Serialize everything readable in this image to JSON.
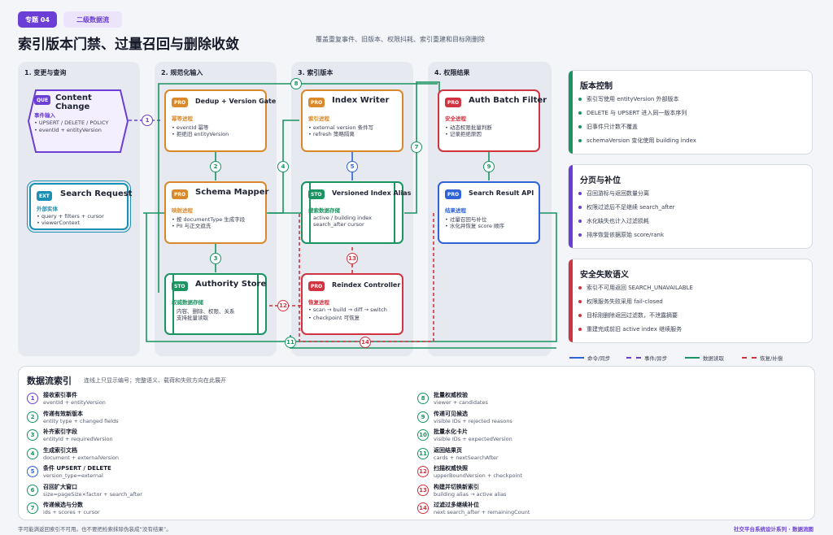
{
  "header": {
    "tag1": "专题 04",
    "tag2": "二级数据流",
    "title": "索引版本门禁、过量召回与删除收敛",
    "subtitle": "覆盖重复事件、旧版本、权限抖耗、索引重建和目标刚删除"
  },
  "panels": [
    {
      "title": "1. 变更与查询"
    },
    {
      "title": "2. 规范化输入"
    },
    {
      "title": "3. 索引版本"
    },
    {
      "title": "4. 权限结果"
    }
  ],
  "nodes": {
    "content_change": {
      "badge": "QUE",
      "title": "Content Change",
      "sub": "事件输入",
      "lines": [
        "UPSERT / DELETE / POLICY",
        "eventId + entityVersion"
      ]
    },
    "search_request": {
      "badge": "EXT",
      "title": "Search Request",
      "sub": "外部实体",
      "lines": [
        "query + filters + cursor",
        "viewerContext"
      ]
    },
    "dedup": {
      "badge": "PRO",
      "title": "Dedup + Version Gate",
      "sub": "幂等进程",
      "lines": [
        "eventId 幂等",
        "拒绝旧 entityVersion"
      ]
    },
    "schema_mapper": {
      "badge": "PRO",
      "title": "Schema Mapper",
      "sub": "映射进程",
      "lines": [
        "按 documentType 生成字段",
        "PII 与正文遮洗"
      ]
    },
    "authority_store": {
      "badge": "STO",
      "title": "Authority Store",
      "sub": "权威数据存储",
      "lines": [
        "内容、删除、权限、关系",
        "支持批量读取"
      ]
    },
    "index_writer": {
      "badge": "PRO",
      "title": "Index Writer",
      "sub": "索引进程",
      "lines": [
        "external version 条件写",
        "refresh 策略隔离"
      ]
    },
    "versioned_alias": {
      "badge": "STO",
      "title": "Versioned Index Alias",
      "sub": "搜索数据存储",
      "lines": [
        "active / building index",
        "search_after cursor"
      ]
    },
    "reindex": {
      "badge": "PRO",
      "title": "Reindex Controller",
      "sub": "恢复进程",
      "lines": [
        "scan → build → diff → switch",
        "checkpoint 可恢复"
      ]
    },
    "auth_batch": {
      "badge": "PRO",
      "title": "Auth Batch Filter",
      "sub": "安全进程",
      "lines": [
        "动态权限批量判断",
        "记录拒绝原因"
      ]
    },
    "search_result": {
      "badge": "PRO",
      "title": "Search Result API",
      "sub": "结果进程",
      "lines": [
        "过量召回与补位",
        "水化并恢复 score 顺序"
      ]
    }
  },
  "flow_numbers": [
    "1",
    "2",
    "3",
    "4",
    "5",
    "6",
    "7",
    "8",
    "9",
    "10",
    "11",
    "12",
    "13",
    "14"
  ],
  "cards": [
    {
      "title": "版本控制",
      "color": "#1a9460",
      "items": [
        "索引写使用 entityVersion 外部版本",
        "DELETE 与 UPSERT 进入同一版本序列",
        "旧事件只计数不覆盖",
        "schemaVersion 变化使用 building index"
      ]
    },
    {
      "title": "分页与补位",
      "color": "#6b3fd6",
      "items": [
        "召回游标与返回数量分离",
        "权限过滤后不足继续 search_after",
        "水化缺失也计入过滤损耗",
        "排序恢复依据原始 score/rank"
      ]
    },
    {
      "title": "安全失败语义",
      "color": "#d03440",
      "items": [
        "索引不可用返回 SEARCH_UNAVAILABLE",
        "权限服务失败采用 fail-closed",
        "目标刚删除返回过滤数，不泄露摘要",
        "重建完成前旧 active index 继续服务"
      ]
    }
  ],
  "legend": [
    {
      "label": "命令/同步",
      "color": "#2f63d6",
      "style": "solid"
    },
    {
      "label": "事件/异步",
      "color": "#6b3fd6",
      "style": "dashed"
    },
    {
      "label": "数据读取",
      "color": "#1a9460",
      "style": "solid"
    },
    {
      "label": "恢复/补偿",
      "color": "#d03440",
      "style": "dashed"
    }
  ],
  "index": {
    "title": "数据流索引",
    "note": "连线上只显示编号；完整语义、载荷和失败方向在此展开",
    "items": [
      {
        "n": "1",
        "label": "接收索引事件",
        "detail": "eventId + entityVersion",
        "color": "#6b3fd6"
      },
      {
        "n": "2",
        "label": "传递有效新版本",
        "detail": "entity type + changed fields",
        "color": "#1a9460"
      },
      {
        "n": "3",
        "label": "补齐索引字段",
        "detail": "entityId + requiredVersion",
        "color": "#1a9460"
      },
      {
        "n": "4",
        "label": "生成索引文档",
        "detail": "document + externalVersion",
        "color": "#1a9460"
      },
      {
        "n": "5",
        "label": "条件 UPSERT / DELETE",
        "detail": "version_type=external",
        "color": "#2f63d6"
      },
      {
        "n": "6",
        "label": "召回扩大窗口",
        "detail": "size=pageSize×factor + search_after",
        "color": "#1a9460"
      },
      {
        "n": "7",
        "label": "传递候选与分数",
        "detail": "ids + scores + cursor",
        "color": "#1a9460"
      },
      {
        "n": "8",
        "label": "批量权威校验",
        "detail": "viewer + candidates",
        "color": "#1a9460"
      },
      {
        "n": "9",
        "label": "传递可见候选",
        "detail": "visible IDs + rejected reasons",
        "color": "#1a9460"
      },
      {
        "n": "10",
        "label": "批量水化卡片",
        "detail": "visible IDs + expectedVersion",
        "color": "#1a9460"
      },
      {
        "n": "11",
        "label": "返回结果页",
        "detail": "cards + nextSearchAfter",
        "color": "#1a9460"
      },
      {
        "n": "12",
        "label": "扫描权威快照",
        "detail": "upperBoundVersion + checkpoint",
        "color": "#d03440"
      },
      {
        "n": "13",
        "label": "构建并切换新索引",
        "detail": "building alias → active alias",
        "color": "#d03440"
      },
      {
        "n": "14",
        "label": "过滤过多继续补位",
        "detail": "next search_after + remainingCount",
        "color": "#d03440"
      }
    ]
  },
  "footer": {
    "note": "字可能满返回索引不可用。也不要把检索抹除伪装成“没有结果”。",
    "brand": "社交平台系统设计系列 · 数据流图"
  }
}
